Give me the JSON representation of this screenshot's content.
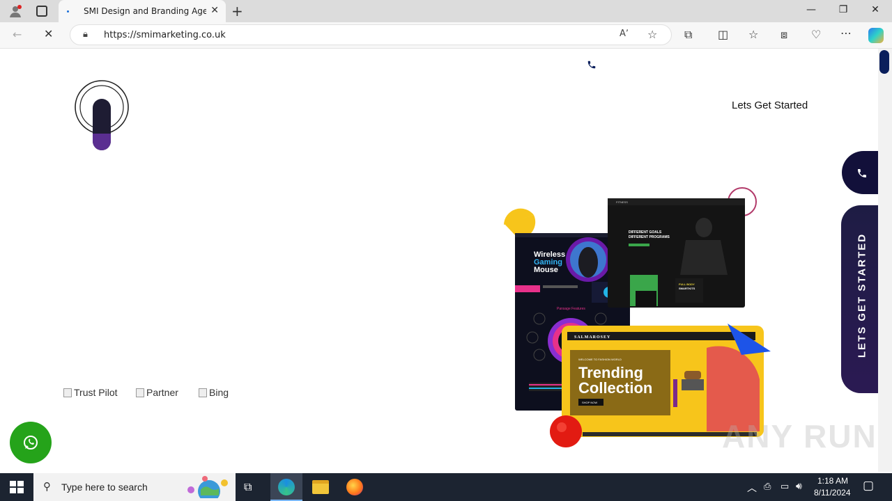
{
  "browser": {
    "tab_title": "SMI Design and Branding Agency",
    "url": "https://smimarketing.co.uk"
  },
  "page": {
    "lets_get_started_top": "Lets Get Started",
    "brands": [
      {
        "alt": "Trust Pilot"
      },
      {
        "alt": "Partner"
      },
      {
        "alt": "Bing"
      }
    ],
    "side_cta": "LETS GET STARTED",
    "hero_mockups": {
      "gaming_title": "Wireless Gaming Mouse",
      "gaming_section": "Pansage Features",
      "fitness_line1": "DIFFERENT GOALS",
      "fitness_line2": "DIFFERENT PROGRAMS",
      "fitness_card": "FULL BODY SMARTKITS",
      "fashion_brand": "SALMAROSEY",
      "fashion_kicker": "WELCOME TO FASHION WORLD",
      "fashion_title_1": "Trending",
      "fashion_title_2": "Collection",
      "fashion_button": "SHOP NOW"
    }
  },
  "taskbar": {
    "search_placeholder": "Type here to search",
    "time": "1:18 AM",
    "date": "8/11/2024"
  },
  "watermark": "ANY RUN",
  "colors": {
    "navy": "#12103a",
    "whatsapp_green": "#25a31a",
    "accent_yellow": "#f7c51b",
    "accent_red": "#e21b12",
    "accent_blue": "#1d54e8"
  }
}
